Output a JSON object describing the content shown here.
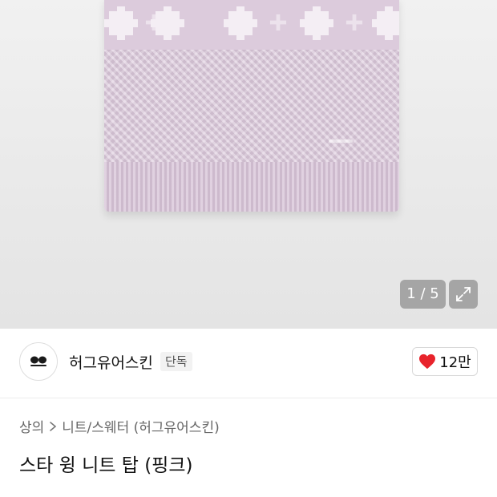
{
  "gallery": {
    "counter": "1 / 5"
  },
  "brand": {
    "name": "허그유어스킨",
    "badge": "단독",
    "likes": "12만"
  },
  "breadcrumb": {
    "category": "상의",
    "subcategory": "니트/스웨터 (허그유어스킨)"
  },
  "product": {
    "title": "스타 윙 니트 탑 (핑크)"
  },
  "colors": {
    "sweater": "#dcc9dc",
    "heart": "#e8232b"
  },
  "icons": {
    "expand": "expand-icon",
    "heart": "heart-icon",
    "chevron": "chevron-right-icon"
  }
}
